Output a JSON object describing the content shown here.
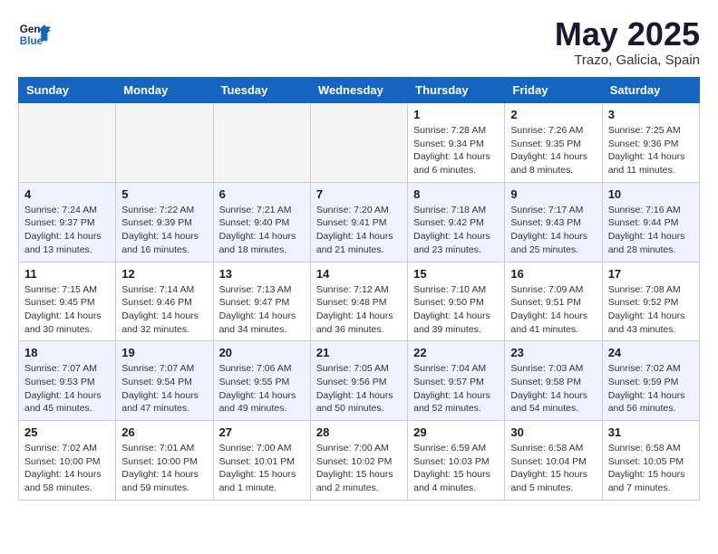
{
  "logo": {
    "line1": "General",
    "line2": "Blue"
  },
  "title": "May 2025",
  "subtitle": "Trazo, Galicia, Spain",
  "days_header": [
    "Sunday",
    "Monday",
    "Tuesday",
    "Wednesday",
    "Thursday",
    "Friday",
    "Saturday"
  ],
  "weeks": [
    [
      {
        "num": "",
        "info": ""
      },
      {
        "num": "",
        "info": ""
      },
      {
        "num": "",
        "info": ""
      },
      {
        "num": "",
        "info": ""
      },
      {
        "num": "1",
        "info": "Sunrise: 7:28 AM\nSunset: 9:34 PM\nDaylight: 14 hours\nand 6 minutes."
      },
      {
        "num": "2",
        "info": "Sunrise: 7:26 AM\nSunset: 9:35 PM\nDaylight: 14 hours\nand 8 minutes."
      },
      {
        "num": "3",
        "info": "Sunrise: 7:25 AM\nSunset: 9:36 PM\nDaylight: 14 hours\nand 11 minutes."
      }
    ],
    [
      {
        "num": "4",
        "info": "Sunrise: 7:24 AM\nSunset: 9:37 PM\nDaylight: 14 hours\nand 13 minutes."
      },
      {
        "num": "5",
        "info": "Sunrise: 7:22 AM\nSunset: 9:39 PM\nDaylight: 14 hours\nand 16 minutes."
      },
      {
        "num": "6",
        "info": "Sunrise: 7:21 AM\nSunset: 9:40 PM\nDaylight: 14 hours\nand 18 minutes."
      },
      {
        "num": "7",
        "info": "Sunrise: 7:20 AM\nSunset: 9:41 PM\nDaylight: 14 hours\nand 21 minutes."
      },
      {
        "num": "8",
        "info": "Sunrise: 7:18 AM\nSunset: 9:42 PM\nDaylight: 14 hours\nand 23 minutes."
      },
      {
        "num": "9",
        "info": "Sunrise: 7:17 AM\nSunset: 9:43 PM\nDaylight: 14 hours\nand 25 minutes."
      },
      {
        "num": "10",
        "info": "Sunrise: 7:16 AM\nSunset: 9:44 PM\nDaylight: 14 hours\nand 28 minutes."
      }
    ],
    [
      {
        "num": "11",
        "info": "Sunrise: 7:15 AM\nSunset: 9:45 PM\nDaylight: 14 hours\nand 30 minutes."
      },
      {
        "num": "12",
        "info": "Sunrise: 7:14 AM\nSunset: 9:46 PM\nDaylight: 14 hours\nand 32 minutes."
      },
      {
        "num": "13",
        "info": "Sunrise: 7:13 AM\nSunset: 9:47 PM\nDaylight: 14 hours\nand 34 minutes."
      },
      {
        "num": "14",
        "info": "Sunrise: 7:12 AM\nSunset: 9:48 PM\nDaylight: 14 hours\nand 36 minutes."
      },
      {
        "num": "15",
        "info": "Sunrise: 7:10 AM\nSunset: 9:50 PM\nDaylight: 14 hours\nand 39 minutes."
      },
      {
        "num": "16",
        "info": "Sunrise: 7:09 AM\nSunset: 9:51 PM\nDaylight: 14 hours\nand 41 minutes."
      },
      {
        "num": "17",
        "info": "Sunrise: 7:08 AM\nSunset: 9:52 PM\nDaylight: 14 hours\nand 43 minutes."
      }
    ],
    [
      {
        "num": "18",
        "info": "Sunrise: 7:07 AM\nSunset: 9:53 PM\nDaylight: 14 hours\nand 45 minutes."
      },
      {
        "num": "19",
        "info": "Sunrise: 7:07 AM\nSunset: 9:54 PM\nDaylight: 14 hours\nand 47 minutes."
      },
      {
        "num": "20",
        "info": "Sunrise: 7:06 AM\nSunset: 9:55 PM\nDaylight: 14 hours\nand 49 minutes."
      },
      {
        "num": "21",
        "info": "Sunrise: 7:05 AM\nSunset: 9:56 PM\nDaylight: 14 hours\nand 50 minutes."
      },
      {
        "num": "22",
        "info": "Sunrise: 7:04 AM\nSunset: 9:57 PM\nDaylight: 14 hours\nand 52 minutes."
      },
      {
        "num": "23",
        "info": "Sunrise: 7:03 AM\nSunset: 9:58 PM\nDaylight: 14 hours\nand 54 minutes."
      },
      {
        "num": "24",
        "info": "Sunrise: 7:02 AM\nSunset: 9:59 PM\nDaylight: 14 hours\nand 56 minutes."
      }
    ],
    [
      {
        "num": "25",
        "info": "Sunrise: 7:02 AM\nSunset: 10:00 PM\nDaylight: 14 hours\nand 58 minutes."
      },
      {
        "num": "26",
        "info": "Sunrise: 7:01 AM\nSunset: 10:00 PM\nDaylight: 14 hours\nand 59 minutes."
      },
      {
        "num": "27",
        "info": "Sunrise: 7:00 AM\nSunset: 10:01 PM\nDaylight: 15 hours\nand 1 minute."
      },
      {
        "num": "28",
        "info": "Sunrise: 7:00 AM\nSunset: 10:02 PM\nDaylight: 15 hours\nand 2 minutes."
      },
      {
        "num": "29",
        "info": "Sunrise: 6:59 AM\nSunset: 10:03 PM\nDaylight: 15 hours\nand 4 minutes."
      },
      {
        "num": "30",
        "info": "Sunrise: 6:58 AM\nSunset: 10:04 PM\nDaylight: 15 hours\nand 5 minutes."
      },
      {
        "num": "31",
        "info": "Sunrise: 6:58 AM\nSunset: 10:05 PM\nDaylight: 15 hours\nand 7 minutes."
      }
    ]
  ]
}
